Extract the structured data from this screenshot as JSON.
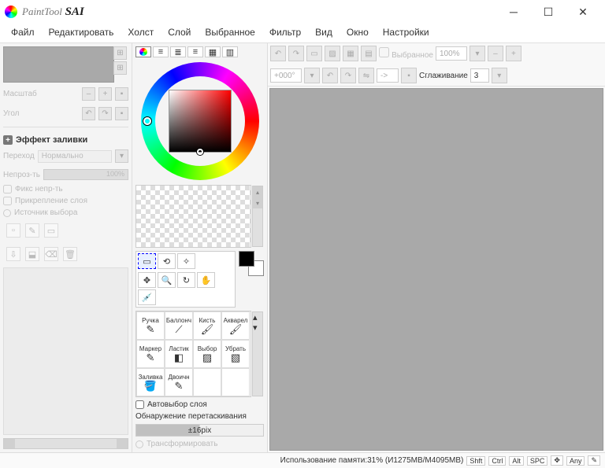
{
  "app": {
    "title_paint": "PaintTool",
    "title_sai": " SAI"
  },
  "menu": [
    "Файл",
    "Редактировать",
    "Холст",
    "Слой",
    "Выбранное",
    "Фильтр",
    "Вид",
    "Окно",
    "Настройки"
  ],
  "left": {
    "scale_label": "Масштаб",
    "angle_label": "Угол",
    "fill_effect": "Эффект заливки",
    "blend_label": "Переход",
    "blend_value": "Нормально",
    "opacity_label": "Непроз-ть",
    "opacity_value": "100%",
    "chk_fix": "Фикс непр-ть",
    "chk_clip": "Прикрепление слоя",
    "radio_src": "Источник выбора"
  },
  "mid": {
    "autoselect": "Автовыбор слоя",
    "drag_detect": "Обнаружение перетаскивания",
    "drag_value": "±16pix",
    "transform": "Трансформировать",
    "brushes": [
      "Ручка",
      "Баллонч",
      "Кисть",
      "Акварел",
      "Маркер",
      "Ластик",
      "Выбор",
      "Убрать",
      "Заливка",
      "Двоичн"
    ]
  },
  "toolbar": {
    "selection": "Выбранное",
    "zoom": "100%",
    "rotation": "+000°",
    "arrow": "->",
    "smoothing_label": "Сглаживание",
    "smoothing_value": "3"
  },
  "status": {
    "memory": "Использование памяти:31% (И1275MB/M4095MB)",
    "keys": [
      "Shft",
      "Ctrl",
      "Alt",
      "SPC",
      "✥",
      "Any",
      "✎"
    ]
  }
}
